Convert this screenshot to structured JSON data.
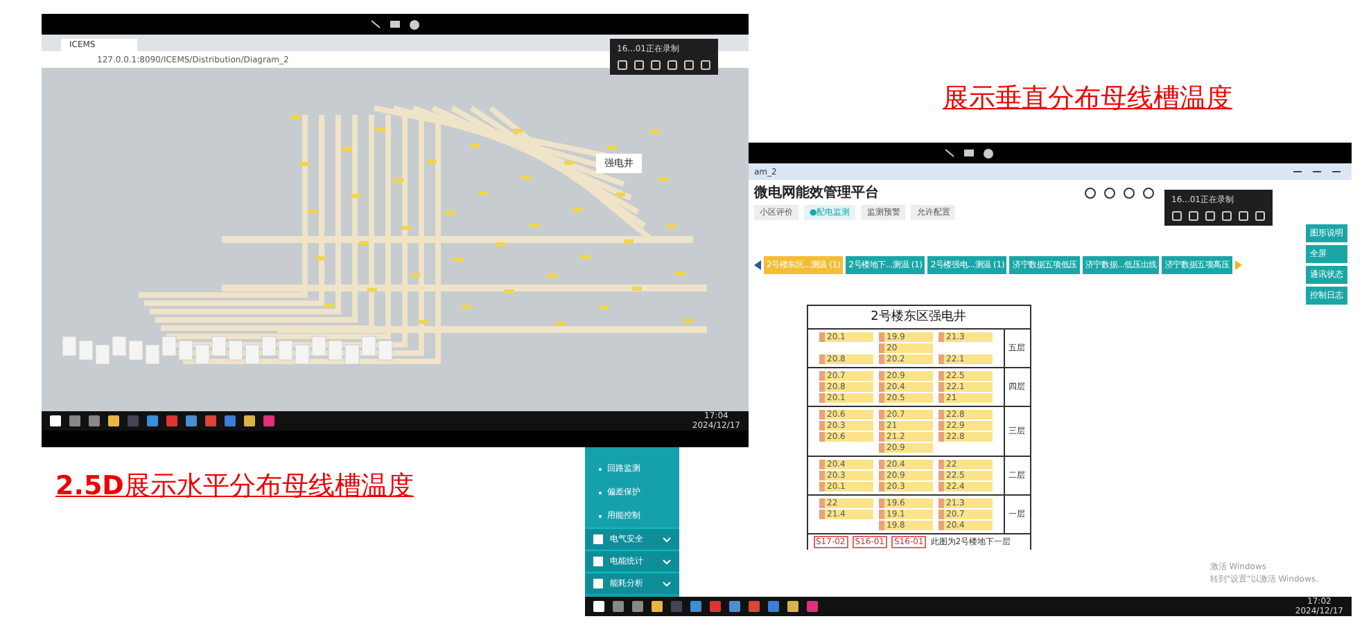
{
  "captions": [
    {
      "text": "展示垂直分布母线槽温度"
    },
    {
      "text": "**2.5D**展示水平分布母线槽温度"
    }
  ],
  "left_screen": {
    "browser_tab": "ICEMS",
    "address": "127.0.0.1:8090/ICEMS/Distribution/Diagram_2",
    "recorder_title": "16...01正在录制",
    "room_label": "强电井",
    "taskbar_time": "17:04",
    "taskbar_date": "2024/12/17"
  },
  "right_screen": {
    "page_tab": "am_2",
    "app_title": "微电网能效管理平台",
    "recorder_title": "16...01正在录制",
    "nav_tabs": [
      {
        "label": "小区评价",
        "selected": false
      },
      {
        "label": "●配电监测",
        "selected": true
      },
      {
        "label": "监测预警",
        "selected": false
      },
      {
        "label": "允许配置",
        "selected": false
      }
    ],
    "shaft_tabs": [
      {
        "label": "2号楼东区...测温 (1)",
        "selected": true
      },
      {
        "label": "2号楼地下...测温 (1)",
        "selected": false
      },
      {
        "label": "2号楼强电...测温 (1)",
        "selected": false
      },
      {
        "label": "济宁数据五项低压",
        "selected": false
      },
      {
        "label": "济宁数据...低压出线",
        "selected": false
      },
      {
        "label": "济宁数据五项高压",
        "selected": false
      }
    ],
    "actions": [
      "图形说明",
      "全屏",
      "通讯状态",
      "控制日志"
    ],
    "sidebar": [
      {
        "label": "回路监测",
        "kind": "sub"
      },
      {
        "label": "偏差保护",
        "kind": "sub"
      },
      {
        "label": "用能控制",
        "kind": "sub"
      },
      {
        "label": "电气安全",
        "kind": "group"
      },
      {
        "label": "电能统计",
        "kind": "group"
      },
      {
        "label": "能耗分析",
        "kind": "group"
      }
    ],
    "shaft": {
      "title": "2号楼东区强电井",
      "floors": [
        {
          "name": "五层",
          "rows": [
            [
              "20.1",
              "19.9",
              "21.3"
            ],
            [
              "",
              "20",
              ""
            ],
            [
              "20.8",
              "20.2",
              "22.1"
            ]
          ]
        },
        {
          "name": "四层",
          "rows": [
            [
              "20.7",
              "20.9",
              "22.5"
            ],
            [
              "20.8",
              "20.4",
              "22.1"
            ],
            [
              "20.1",
              "20.5",
              "21"
            ]
          ]
        },
        {
          "name": "三层",
          "rows": [
            [
              "20.6",
              "20.7",
              "22.8"
            ],
            [
              "20.3",
              "21",
              "22.9"
            ],
            [
              "20.6",
              "21.2",
              "22.8"
            ],
            [
              "",
              "20.9",
              ""
            ]
          ]
        },
        {
          "name": "二层",
          "rows": [
            [
              "20.4",
              "20.4",
              "22"
            ],
            [
              "20.3",
              "20.9",
              "22.5"
            ],
            [
              "20.1",
              "20.3",
              "22.4"
            ]
          ]
        },
        {
          "name": "一层",
          "rows": [
            [
              "22",
              "19.6",
              "21.3"
            ],
            [
              "21.4",
              "19.1",
              "20.7"
            ],
            [
              "",
              "19.8",
              "20.4"
            ]
          ]
        }
      ],
      "base_tags": [
        "S17-02",
        "S16-01",
        "S16-01"
      ],
      "base_note": "此图为2号楼地下一层"
    },
    "activation_title": "激活 Windows",
    "activation_hint": "转到\"设置\"以激活 Windows。",
    "taskbar_time": "17:02",
    "taskbar_date": "2024/12/17"
  }
}
